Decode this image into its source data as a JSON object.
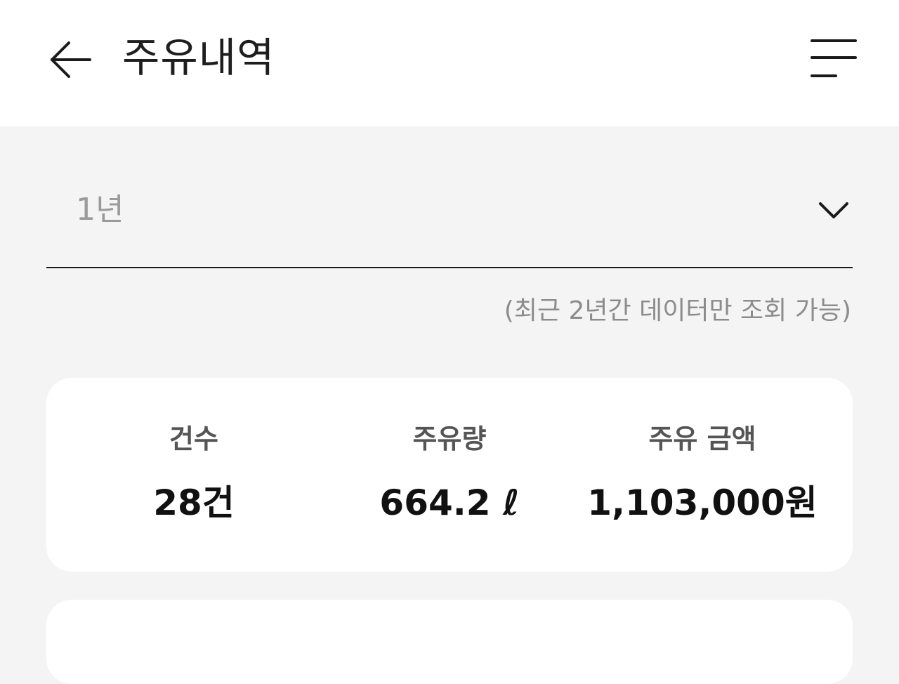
{
  "header": {
    "title": "주유내역",
    "back_icon": "arrow-left-icon",
    "menu_icon": "menu-icon"
  },
  "filter": {
    "period_value": "1년",
    "dropdown_icon": "chevron-down-icon",
    "notice": "(최근 2년간 데이터만 조회 가능)"
  },
  "summary": {
    "stats": [
      {
        "label": "건수",
        "value": "28건"
      },
      {
        "label": "주유량",
        "value": "664.2 ℓ"
      },
      {
        "label": "주유 금액",
        "value": "1,103,000원"
      }
    ]
  },
  "colors": {
    "background": "#f4f4f4",
    "card": "#ffffff",
    "text_primary": "#111111",
    "text_muted": "#9a9a9a"
  }
}
